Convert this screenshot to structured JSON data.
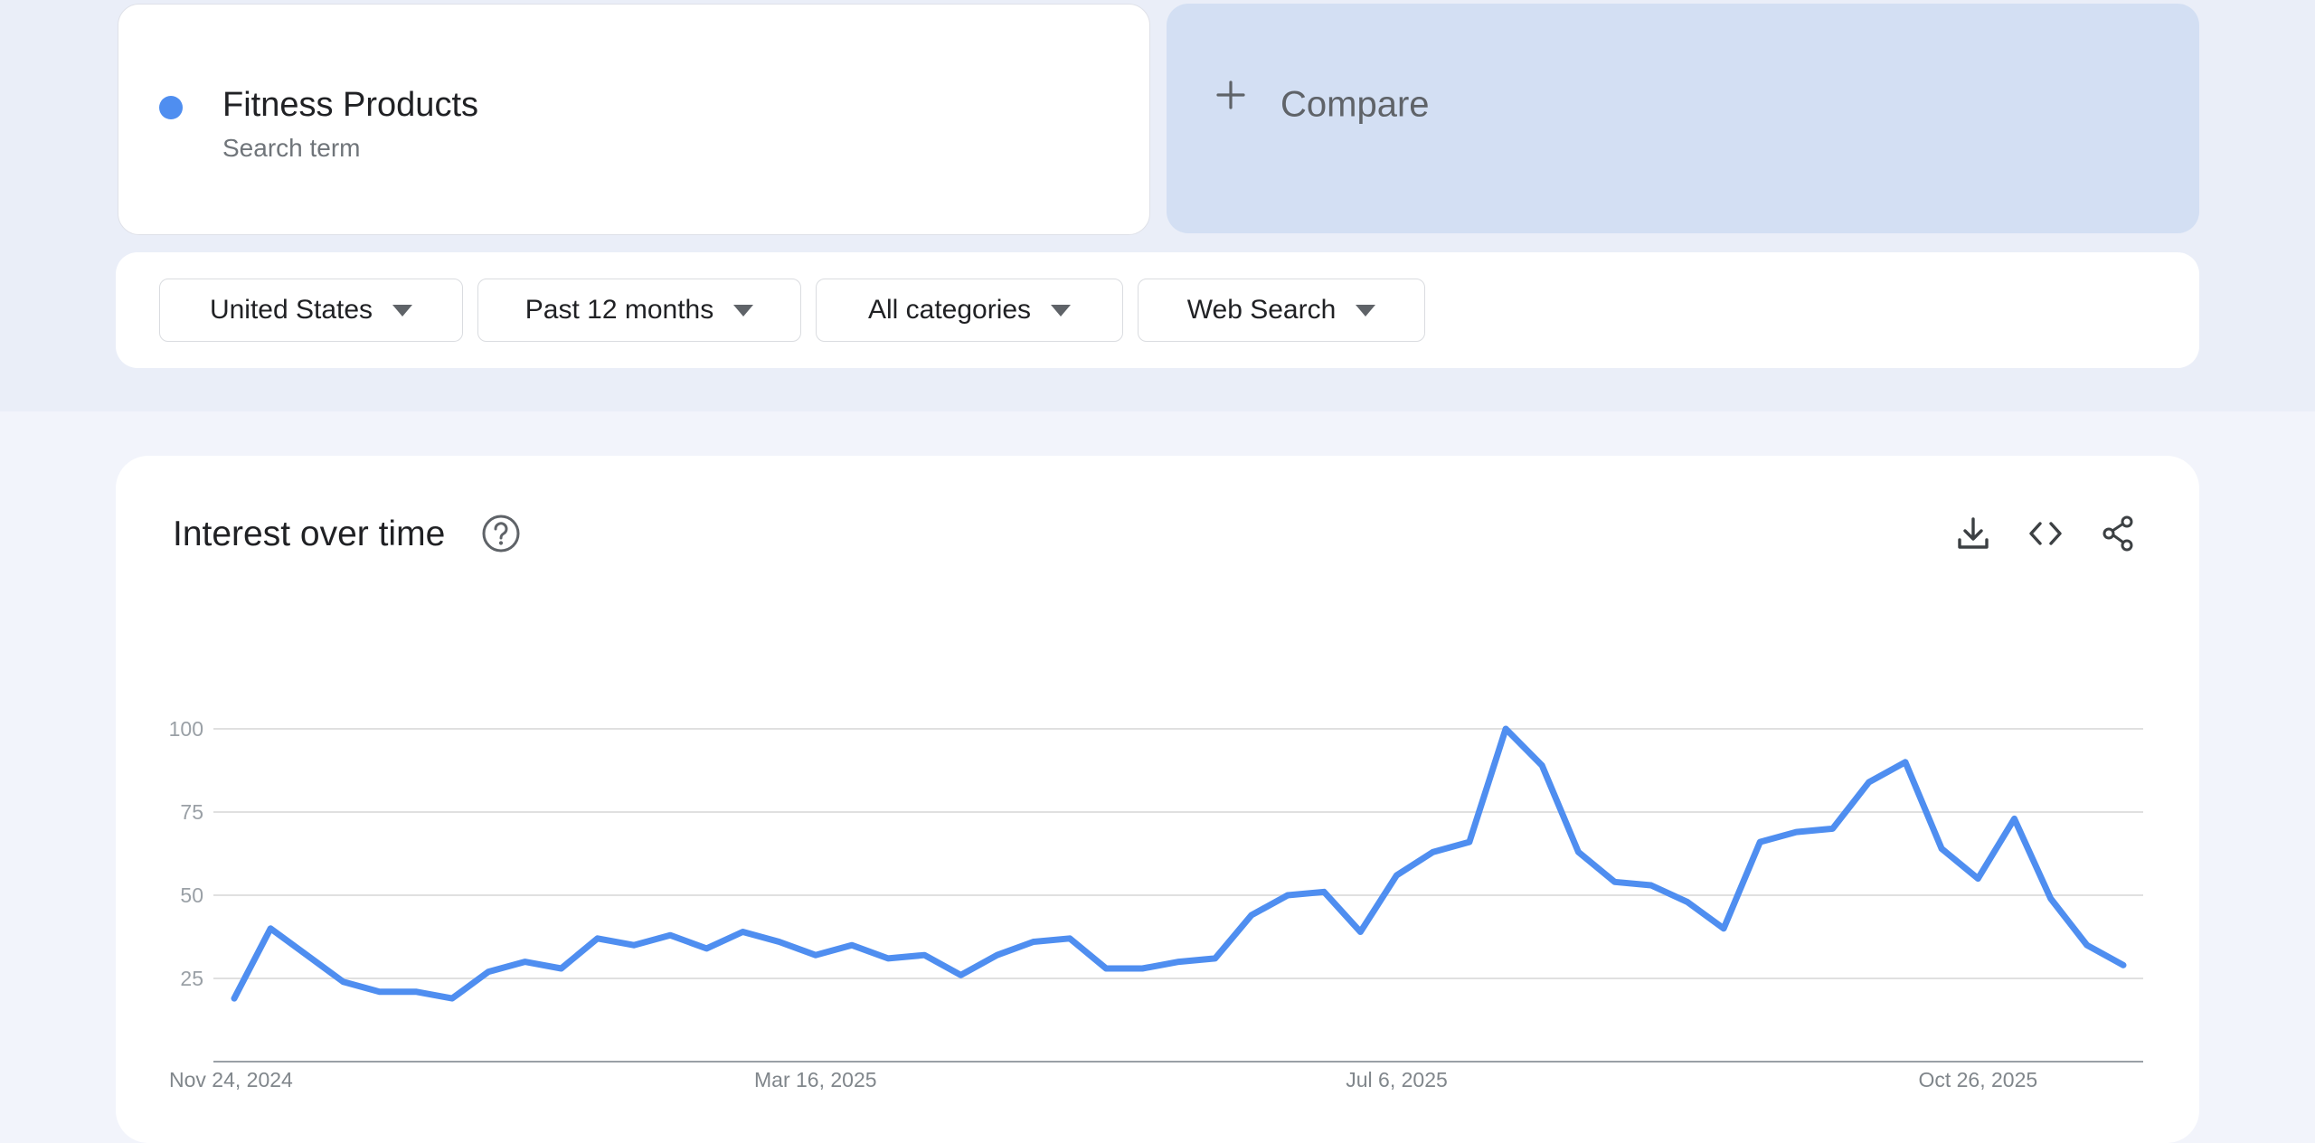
{
  "search_term": {
    "title": "Fitness Products",
    "subtitle": "Search term",
    "color": "#4f8ef0"
  },
  "compare": {
    "label": "Compare",
    "icon": "plus-icon"
  },
  "filters": [
    {
      "label": "United States",
      "icon": "caret-down-icon"
    },
    {
      "label": "Past 12 months",
      "icon": "caret-down-icon"
    },
    {
      "label": "All categories",
      "icon": "caret-down-icon"
    },
    {
      "label": "Web Search",
      "icon": "caret-down-icon"
    }
  ],
  "interest_card": {
    "title": "Interest over time",
    "icons": [
      "help-icon",
      "download-icon",
      "embed-code-icon",
      "share-icon"
    ]
  },
  "chart_data": {
    "type": "line",
    "title": "",
    "xlabel": "",
    "ylabel": "",
    "ylim": [
      0,
      100
    ],
    "yticks": [
      25,
      50,
      75,
      100
    ],
    "xtick_labels": [
      "Nov 24, 2024",
      "Mar 16, 2025",
      "Jul 6, 2025",
      "Oct 26, 2025"
    ],
    "grid": true,
    "color": "#4f8ef0",
    "x": [
      "2024-11-24",
      "2024-12-01",
      "2024-12-08",
      "2024-12-15",
      "2024-12-22",
      "2024-12-29",
      "2025-01-05",
      "2025-01-12",
      "2025-01-19",
      "2025-01-26",
      "2025-02-02",
      "2025-02-09",
      "2025-02-16",
      "2025-02-23",
      "2025-03-02",
      "2025-03-09",
      "2025-03-16",
      "2025-03-23",
      "2025-03-30",
      "2025-04-06",
      "2025-04-13",
      "2025-04-20",
      "2025-04-27",
      "2025-05-04",
      "2025-05-11",
      "2025-05-18",
      "2025-05-25",
      "2025-06-01",
      "2025-06-08",
      "2025-06-15",
      "2025-06-22",
      "2025-06-29",
      "2025-07-06",
      "2025-07-13",
      "2025-07-20",
      "2025-07-27",
      "2025-08-03",
      "2025-08-10",
      "2025-08-17",
      "2025-08-24",
      "2025-08-31",
      "2025-09-07",
      "2025-09-14",
      "2025-09-21",
      "2025-09-28",
      "2025-10-05",
      "2025-10-12",
      "2025-10-19",
      "2025-10-26",
      "2025-11-02",
      "2025-11-09",
      "2025-11-16",
      "2025-11-23"
    ],
    "series": [
      {
        "values": [
          19,
          40,
          32,
          24,
          21,
          21,
          19,
          27,
          30,
          28,
          37,
          35,
          38,
          34,
          39,
          36,
          32,
          35,
          31,
          32,
          26,
          32,
          36,
          37,
          28,
          28,
          30,
          31,
          44,
          50,
          51,
          39,
          56,
          63,
          66,
          100,
          89,
          63,
          54,
          53,
          48,
          40,
          66,
          69,
          70,
          84,
          90,
          64,
          55,
          73,
          49,
          35,
          29
        ]
      }
    ]
  }
}
